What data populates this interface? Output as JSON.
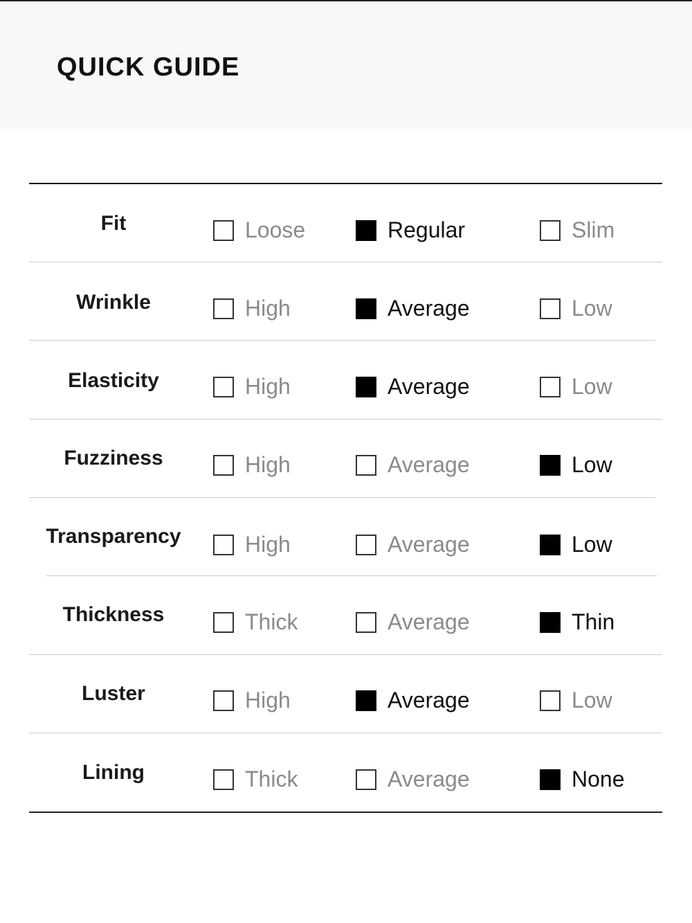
{
  "header": {
    "title": "QUICK GUIDE"
  },
  "rows": [
    {
      "label": "Fit",
      "options": [
        {
          "label": "Loose",
          "checked": false
        },
        {
          "label": "Regular",
          "checked": true
        },
        {
          "label": "Slim",
          "checked": false
        }
      ]
    },
    {
      "label": "Wrinkle",
      "options": [
        {
          "label": "High",
          "checked": false
        },
        {
          "label": "Average",
          "checked": true
        },
        {
          "label": "Low",
          "checked": false
        }
      ]
    },
    {
      "label": "Elasticity",
      "options": [
        {
          "label": "High",
          "checked": false
        },
        {
          "label": "Average",
          "checked": true
        },
        {
          "label": "Low",
          "checked": false
        }
      ]
    },
    {
      "label": "Fuzziness",
      "options": [
        {
          "label": "High",
          "checked": false
        },
        {
          "label": "Average",
          "checked": false
        },
        {
          "label": "Low",
          "checked": true
        }
      ]
    },
    {
      "label": "Transparency",
      "options": [
        {
          "label": "High",
          "checked": false
        },
        {
          "label": "Average",
          "checked": false
        },
        {
          "label": "Low",
          "checked": true
        }
      ]
    },
    {
      "label": "Thickness",
      "options": [
        {
          "label": "Thick",
          "checked": false
        },
        {
          "label": "Average",
          "checked": false
        },
        {
          "label": "Thin",
          "checked": true
        }
      ]
    },
    {
      "label": "Luster",
      "options": [
        {
          "label": "High",
          "checked": false
        },
        {
          "label": "Average",
          "checked": true
        },
        {
          "label": "Low",
          "checked": false
        }
      ]
    },
    {
      "label": "Lining",
      "options": [
        {
          "label": "Thick",
          "checked": false
        },
        {
          "label": "Average",
          "checked": false
        },
        {
          "label": "None",
          "checked": true
        }
      ]
    }
  ]
}
